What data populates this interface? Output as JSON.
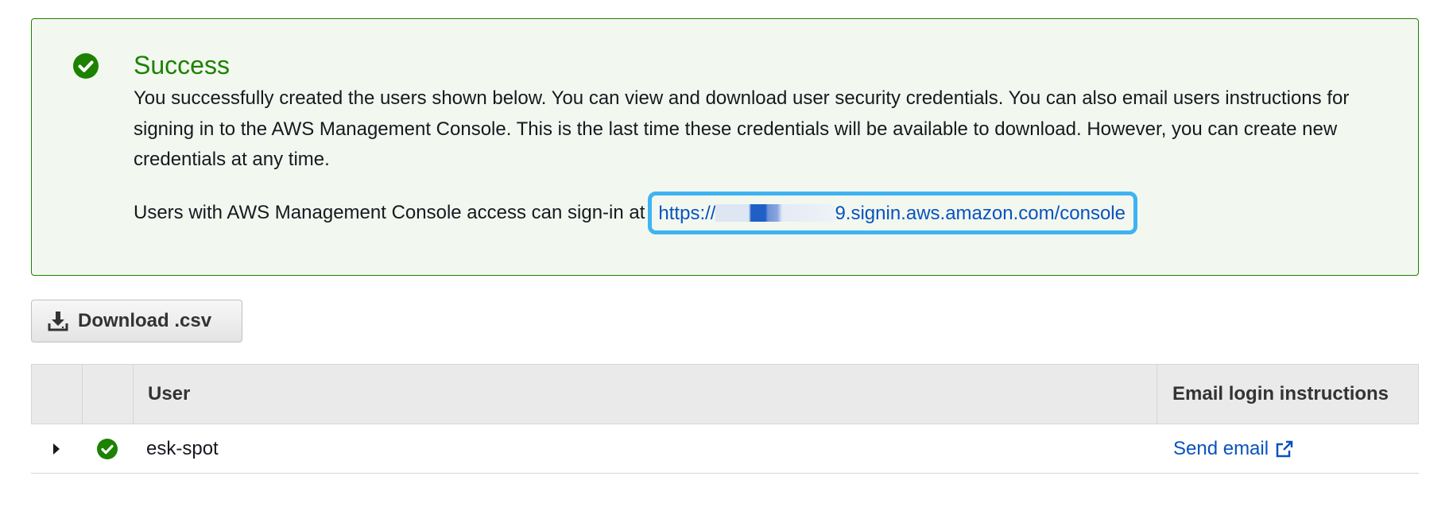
{
  "alert": {
    "title": "Success",
    "message": "You successfully created the users shown below. You can view and download user security credentials. You can also email users instructions for signing in to the AWS Management Console. This is the last time these credentials will be available to download. However, you can create new credentials at any time.",
    "signin_prefix": "Users with AWS Management Console access can sign-in at",
    "signin_url_start": "https://",
    "signin_url_end": "9.signin.aws.amazon.com/console",
    "icon": "check-circle-icon",
    "accent_color": "#1d8102"
  },
  "toolbar": {
    "download_label": "Download .csv",
    "download_icon": "download-icon"
  },
  "table": {
    "columns": [
      "",
      "",
      "User",
      "Email login instructions"
    ],
    "rows": [
      {
        "user": "esk-spot",
        "status_icon": "check-circle-icon",
        "email_action": "Send email",
        "email_icon": "external-link-icon"
      }
    ]
  },
  "colors": {
    "link": "#0a52bf",
    "highlight_border": "#3fb3f2"
  }
}
